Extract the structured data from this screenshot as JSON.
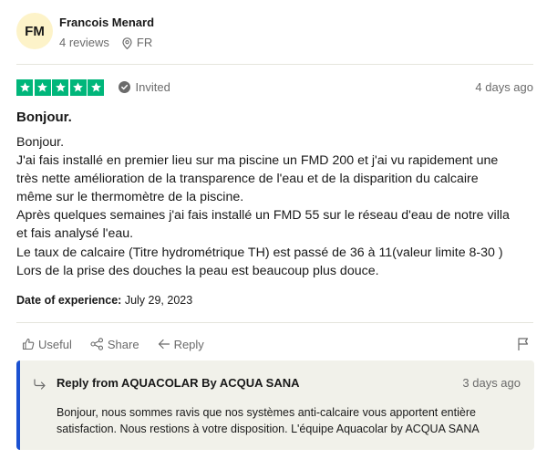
{
  "reviewer": {
    "initials": "FM",
    "name": "Francois Menard",
    "reviews_count": "4 reviews",
    "country": "FR"
  },
  "rating": {
    "stars": 5,
    "max_stars": 5,
    "invited_label": "Invited",
    "posted_ago": "4 days ago"
  },
  "review": {
    "title": "Bonjour.",
    "body_lines": [
      "Bonjour.",
      "J'ai fais installé en premier lieu sur ma piscine un FMD 200 et j'ai vu rapidement une",
      "très nette amélioration de la transparence de l'eau et de la disparition du calcaire",
      "même sur le thermomètre de la piscine.",
      "Après quelques semaines j'ai fais installé un FMD 55 sur le réseau d'eau de notre villa",
      "et fais analysé l'eau.",
      "Le taux de calcaire (Titre hydrométrique TH) est passé de 36 à 11(valeur limite 8-30 )",
      "Lors de la prise des douches la peau est beaucoup plus douce."
    ],
    "experience_label": "Date of experience:",
    "experience_date": "July 29, 2023"
  },
  "actions": {
    "useful_label": "Useful",
    "share_label": "Share",
    "reply_label": "Reply"
  },
  "company_reply": {
    "from_label": "Reply from AQUACOLAR By ACQUA SANA",
    "posted_ago": "3 days ago",
    "text": "Bonjour, nous sommes ravis que nos systèmes anti-calcaire vous apportent entière satisfaction. Nous restions à votre disposition. L'équipe Aquacolar by ACQUA SANA"
  },
  "colors": {
    "star_green": "#00b67a",
    "avatar_bg": "#fdf3c9",
    "reply_bg": "#f1f1ea",
    "reply_accent": "#1b51d1",
    "muted_text": "#6b6b6b"
  }
}
